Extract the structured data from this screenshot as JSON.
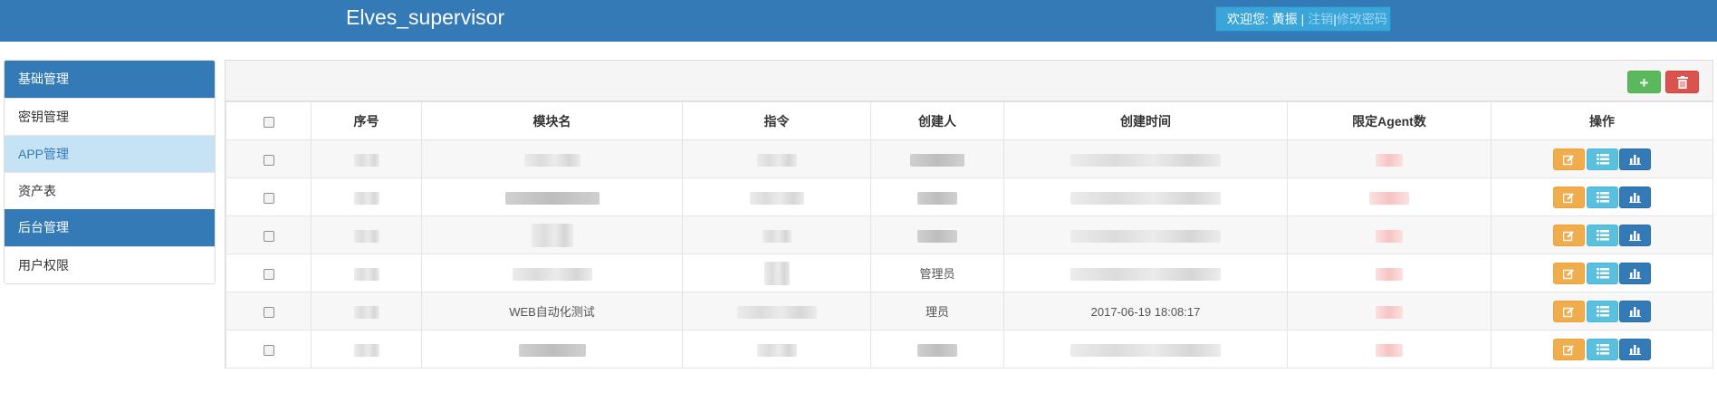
{
  "header": {
    "brand": "Elves_supervisor",
    "welcome_prefix": "欢迎您: 黄振 |",
    "logout_link": "注销",
    "separator": "|",
    "change_password_link": "修改密码"
  },
  "sidebar": {
    "items": [
      {
        "label": "基础管理",
        "type": "header"
      },
      {
        "label": "密钥管理",
        "type": "item"
      },
      {
        "label": "APP管理",
        "type": "item",
        "active": true
      },
      {
        "label": "资产表",
        "type": "item"
      },
      {
        "label": "后台管理",
        "type": "header"
      },
      {
        "label": "用户权限",
        "type": "item"
      }
    ]
  },
  "toolbar": {
    "add_icon": "plus-icon",
    "delete_icon": "trash-icon"
  },
  "table": {
    "columns": [
      "序号",
      "模块名",
      "指令",
      "创建人",
      "创建时间",
      "限定Agent数",
      "操作"
    ],
    "row_fragments": {
      "row4_creator": "管理员",
      "row5_module": "WEB自动化测试",
      "row5_creator": "理员",
      "row5_time": "2017-06-19 18:08:17"
    }
  },
  "colors": {
    "header_bg": "#337ab7",
    "add_button": "#5cb85c",
    "delete_button": "#d9534f",
    "edit_button": "#f0ad4e",
    "list_button": "#5bc0de",
    "chart_button": "#337ab7"
  }
}
